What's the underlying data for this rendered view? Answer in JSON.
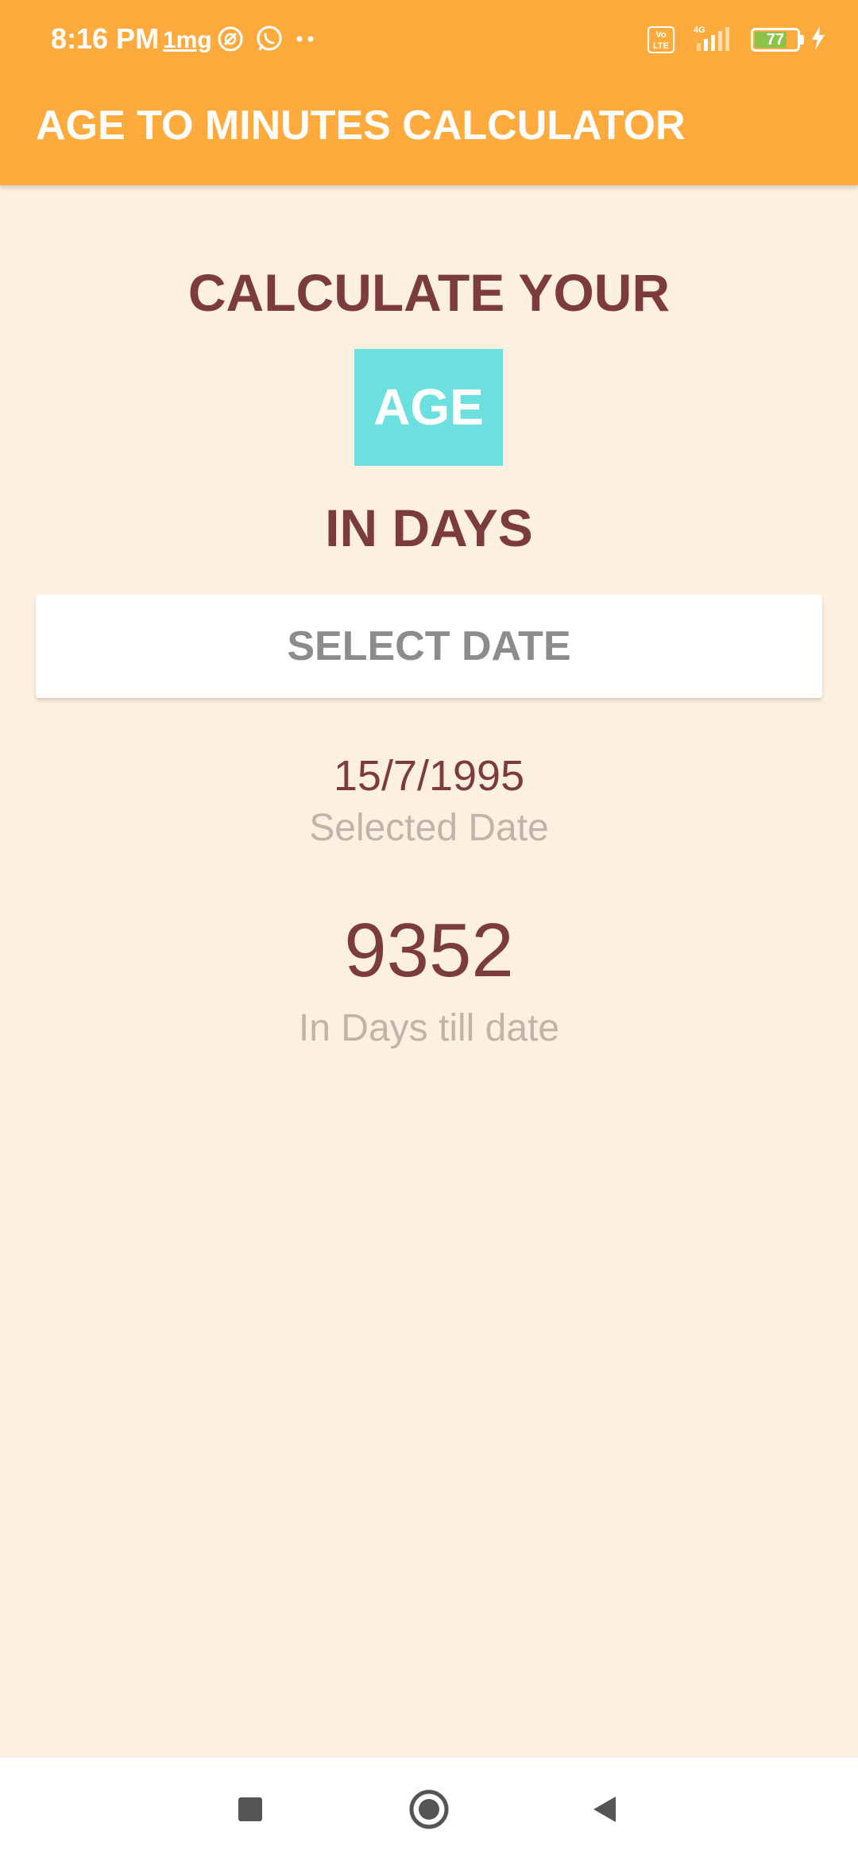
{
  "status_bar": {
    "time": "8:16 PM",
    "app_badge_text": "1mg",
    "volte_text": "Vo LTE",
    "network_text": "4G",
    "battery_level": "77"
  },
  "app_bar": {
    "title": "AGE TO MINUTES CALCULATOR"
  },
  "headline": {
    "line1": "CALCULATE YOUR",
    "highlight": "AGE",
    "line2": "IN DAYS"
  },
  "select_button": {
    "label": "SELECT DATE"
  },
  "selected_date": {
    "value": "15/7/1995",
    "caption": "Selected Date"
  },
  "result": {
    "value": "9352",
    "caption": "In Days till date"
  },
  "colors": {
    "app_bar": "#FFAA3C",
    "background": "#FDF0E0",
    "accent_text": "#7B3B3F",
    "highlight_box": "#6CE0DF",
    "caption_text": "#BDB5AA"
  },
  "nav_bar": {
    "icons": [
      "recents-square-icon",
      "home-circle-icon",
      "back-triangle-icon"
    ]
  }
}
